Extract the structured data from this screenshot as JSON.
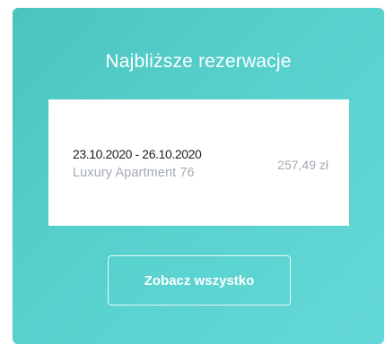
{
  "card": {
    "title": "Najbliższe rezerwacje",
    "reservations": [
      {
        "dates": "23.10.2020 - 26.10.2020",
        "name": "Luxury Apartment 76",
        "price": "257,49 zł"
      }
    ],
    "view_all_label": "Zobacz wszystko"
  },
  "colors": {
    "card_gradient_start": "#4cc4bd",
    "card_gradient_end": "#63d8d8",
    "text_on_card": "#ffffff",
    "secondary_text": "#a3aab2"
  }
}
